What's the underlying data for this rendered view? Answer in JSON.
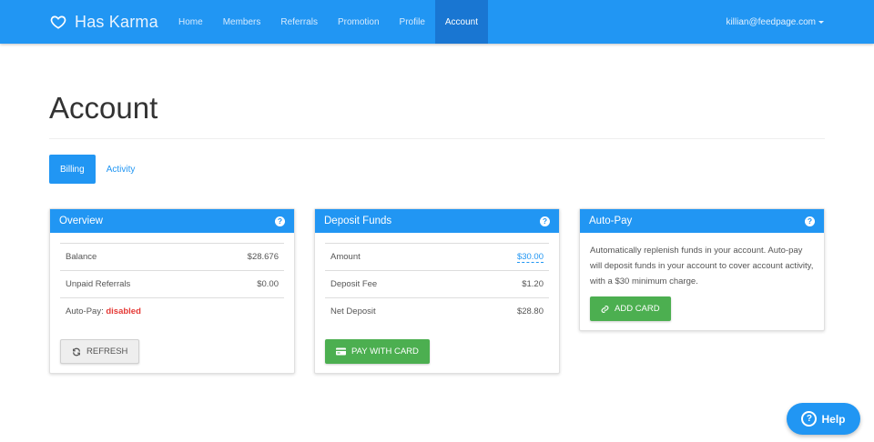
{
  "nav": {
    "brand": "Has Karma",
    "items": [
      {
        "label": "Home",
        "active": false
      },
      {
        "label": "Members",
        "active": false
      },
      {
        "label": "Referrals",
        "active": false
      },
      {
        "label": "Promotion",
        "active": false
      },
      {
        "label": "Profile",
        "active": false
      },
      {
        "label": "Account",
        "active": true
      }
    ],
    "user_email": "killian@feedpage.com",
    "accent_color": "#2196f3"
  },
  "page": {
    "title": "Account"
  },
  "tabs": [
    {
      "label": "Billing",
      "active": true
    },
    {
      "label": "Activity",
      "active": false
    }
  ],
  "overview": {
    "title": "Overview",
    "rows": [
      {
        "label": "Balance",
        "value": "$28.676"
      },
      {
        "label": "Unpaid Referrals",
        "value": "$0.00"
      }
    ],
    "autopay_label": "Auto-Pay: ",
    "autopay_status": "disabled",
    "refresh_label": "REFRESH"
  },
  "deposit": {
    "title": "Deposit Funds",
    "rows": [
      {
        "label": "Amount",
        "value": "$30.00"
      },
      {
        "label": "Deposit Fee",
        "value": "$1.20"
      },
      {
        "label": "Net Deposit",
        "value": "$28.80"
      }
    ],
    "pay_label": "PAY WITH CARD"
  },
  "autopay": {
    "title": "Auto-Pay",
    "description": "Automatically replenish funds in your account. Auto-pay will deposit funds in your account to cover account activity, with a $30 minimum charge.",
    "add_card_label": "ADD CARD"
  },
  "help": {
    "label": "Help"
  },
  "colors": {
    "primary": "#2196f3",
    "success": "#4caf50",
    "danger": "#e53935"
  }
}
